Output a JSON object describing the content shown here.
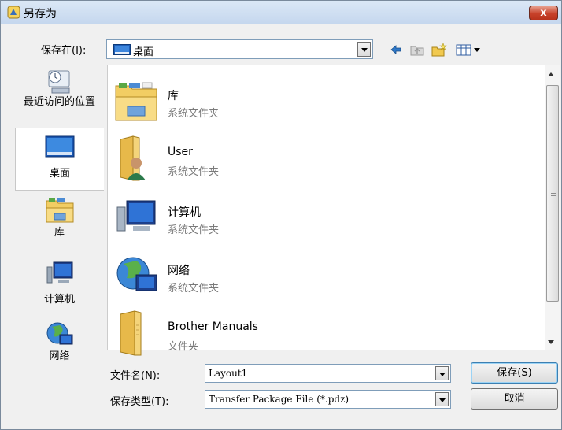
{
  "window": {
    "title": "另存为",
    "close_label": "x"
  },
  "location": {
    "label": "保存在(I):",
    "value": "桌面"
  },
  "toolbar": {
    "icons": [
      "back-arrow-icon",
      "up-folder-icon",
      "new-folder-icon",
      "view-menu-icon"
    ]
  },
  "places": [
    {
      "label": "最近访问的位置",
      "icon": "recent-places-icon"
    },
    {
      "label": "桌面",
      "icon": "desktop-icon",
      "selected": true
    },
    {
      "label": "库",
      "icon": "libraries-icon"
    },
    {
      "label": "计算机",
      "icon": "computer-icon"
    },
    {
      "label": "网络",
      "icon": "network-icon"
    }
  ],
  "files": [
    {
      "name": "库",
      "type": "系统文件夹",
      "icon": "libraries-icon"
    },
    {
      "name": "User",
      "type": "系统文件夹",
      "icon": "user-folder-icon"
    },
    {
      "name": "计算机",
      "type": "系统文件夹",
      "icon": "computer-icon"
    },
    {
      "name": "网络",
      "type": "系统文件夹",
      "icon": "network-icon"
    },
    {
      "name": "Brother Manuals",
      "type": "文件夹",
      "icon": "folder-icon"
    }
  ],
  "filename": {
    "label": "文件名(N):",
    "value": "Layout1"
  },
  "filetype": {
    "label": "保存类型(T):",
    "value": "Transfer Package File (*.pdz)"
  },
  "buttons": {
    "save": "保存(S)",
    "cancel": "取消"
  }
}
